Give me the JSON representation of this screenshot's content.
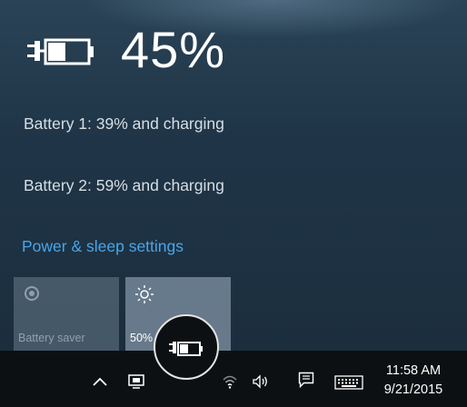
{
  "battery_flyout": {
    "overall_percent": "45%",
    "overall_level": 0.45,
    "batteries": [
      {
        "label": "Battery 1: 39% and charging"
      },
      {
        "label": "Battery 2: 59% and charging"
      }
    ],
    "settings_link": "Power & sleep settings",
    "quick_actions": [
      {
        "label": "Battery saver",
        "icon": "battery-saver-icon",
        "enabled": false
      },
      {
        "label": "50%",
        "icon": "brightness-sun-icon",
        "enabled": true
      }
    ]
  },
  "taskbar": {
    "tray_icons": [
      "chevron-up-icon",
      "monitor-icon",
      "battery-charging-icon",
      "wifi-icon",
      "volume-icon",
      "notification-icon",
      "keyboard-icon"
    ],
    "time": "11:58 AM",
    "date": "9/21/2015"
  },
  "colors": {
    "accent": "#4aa5e8",
    "taskbar": "#0d1012",
    "text": "#ffffff"
  }
}
